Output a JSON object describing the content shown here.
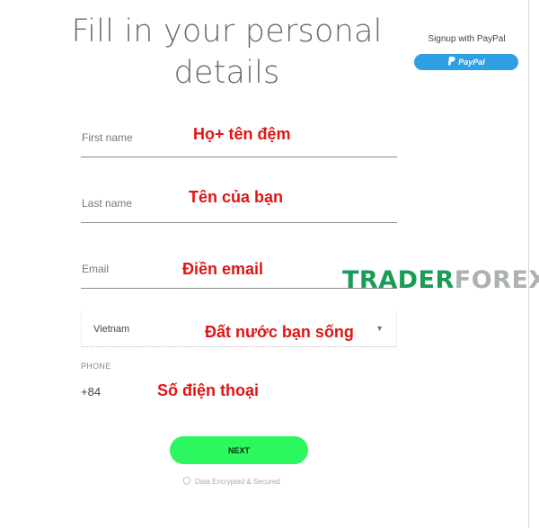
{
  "header": {
    "title_line1": "Fill in your personal",
    "title_line2": "details"
  },
  "paypal": {
    "label": "Signup with PayPal",
    "button_text": "PayPal"
  },
  "form": {
    "first_name": {
      "label": "First name",
      "annotation": "Họ+ tên đệm"
    },
    "last_name": {
      "label": "Last name",
      "annotation": "Tên của bạn"
    },
    "email": {
      "label": "Email",
      "annotation": "Điền email"
    },
    "country": {
      "value": "Vietnam",
      "annotation": "Đất nước bạn sống"
    },
    "phone": {
      "label": "PHONE",
      "code": "+84",
      "annotation": "Số điện thoại"
    }
  },
  "actions": {
    "next_label": "NEXT",
    "secure_note": "Data Encrypted & Secured"
  },
  "watermark": {
    "part1": "TRADER",
    "part2": "FOREX"
  },
  "colors": {
    "annotation": "#e21414",
    "next_button": "#2bf85e",
    "paypal": "#2e9fe3",
    "watermark_green": "#1a9c57"
  },
  "icons": {
    "paypal_icon": "paypal-logo-icon",
    "caret_icon": "chevron-down-icon",
    "secure_icon": "shield-icon"
  }
}
